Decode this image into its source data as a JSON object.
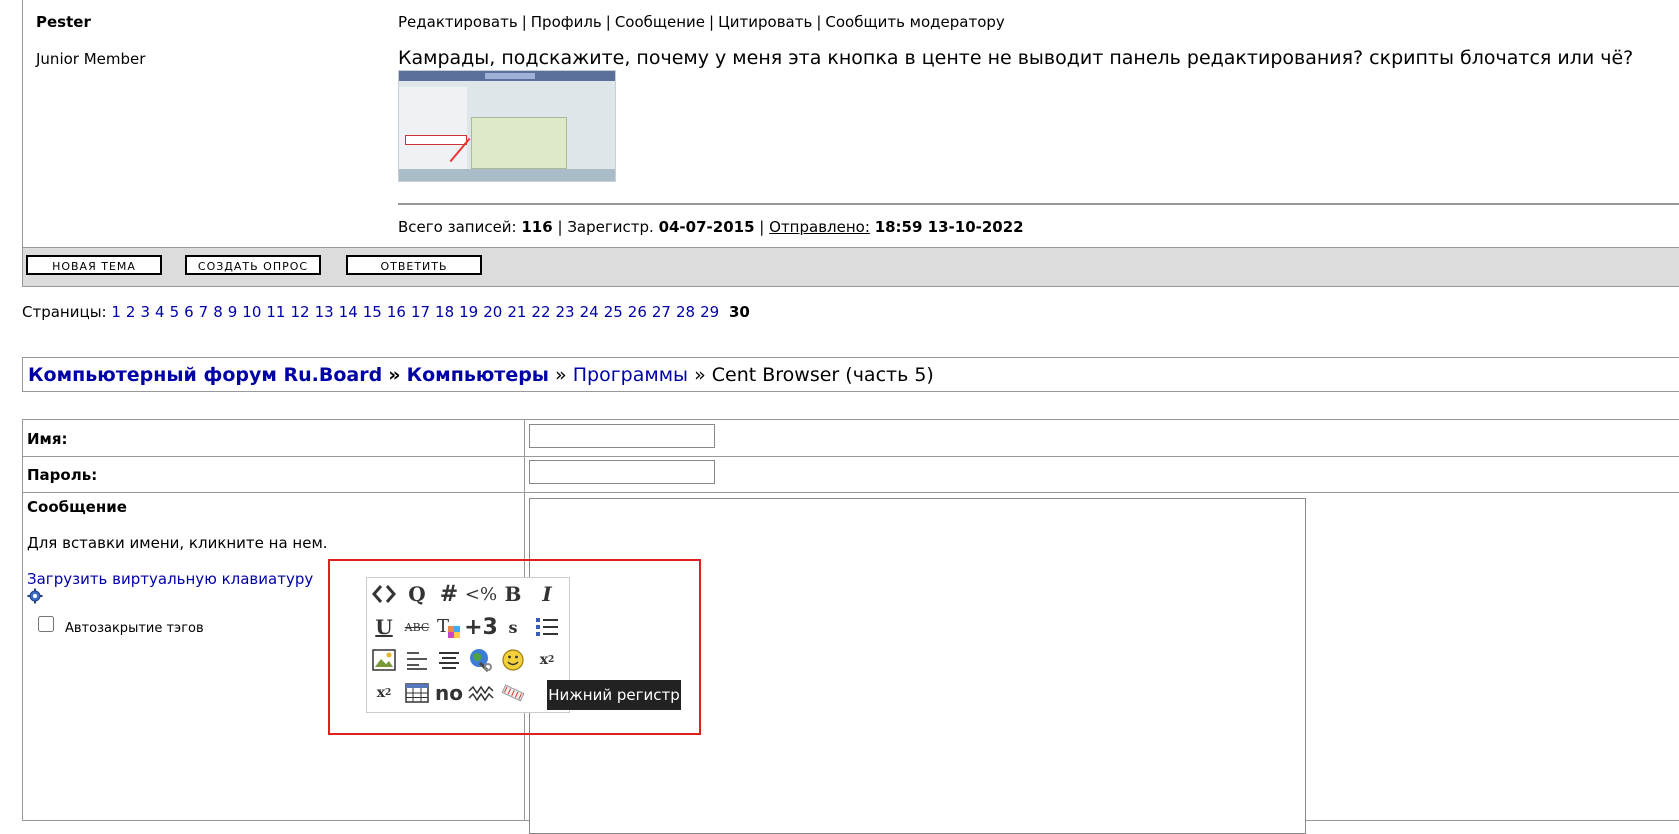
{
  "post": {
    "author": "Pester",
    "rank": "Junior Member",
    "actions": [
      "Редактировать",
      "Профиль",
      "Сообщение",
      "Цитировать",
      "Сообщить модератору"
    ],
    "text": "Камрады, подскажите, почему у меня эта кнопка в центе не выводит панель редактирования? скрипты блочатся или чё?",
    "stats": {
      "posts_label": "Всего записей:",
      "posts": "116",
      "reg_label": "Зарегистр.",
      "reg_date": "04-07-2015",
      "sent_label": "Отправлено:",
      "sent": "18:59 13-10-2022"
    }
  },
  "buttons": {
    "new_topic": "НОВАЯ ТЕМА",
    "new_poll": "СОЗДАТЬ ОПРОС",
    "reply": "ОТВЕТИТЬ"
  },
  "pages": {
    "label": "Страницы:",
    "items": [
      "1",
      "2",
      "3",
      "4",
      "5",
      "6",
      "7",
      "8",
      "9",
      "10",
      "11",
      "12",
      "13",
      "14",
      "15",
      "16",
      "17",
      "18",
      "19",
      "20",
      "21",
      "22",
      "23",
      "24",
      "25",
      "26",
      "27",
      "28",
      "29"
    ],
    "current": "30"
  },
  "breadcrumb": {
    "forum": "Компьютерный форум Ru.Board",
    "sep": "»",
    "section": "Компьютеры",
    "subsection": "Программы",
    "topic": "Cent Browser (часть 5)"
  },
  "form": {
    "name_label": "Имя:",
    "password_label": "Пароль:",
    "message_label": "Сообщение",
    "insert_hint": "Для вставки имени, кликните на нем.",
    "vkbd_link": "Загрузить виртуальную клавиатуру",
    "autoclose_label": "Автозакрытие тэгов"
  },
  "toolbar": {
    "tooltip": "Нижний регистр",
    "icons": [
      "code-icon",
      "quote-icon",
      "hash-icon",
      "less-percent-icon",
      "bold-icon",
      "italic-icon",
      "underline-icon",
      "strikethrough-abc-icon",
      "font-color-icon",
      "size-plus-icon",
      "small-s-icon",
      "list-icon",
      "image-icon",
      "align-left-icon",
      "align-center-icon",
      "globe-link-icon",
      "smiley-icon",
      "subscript-icon",
      "superscript-icon",
      "table-icon",
      "noparse-icon",
      "wave-icon",
      "lowercase-icon"
    ],
    "size_plus_text": "+3",
    "noparse_text": "no"
  },
  "colors": {
    "link": "#0000a8",
    "highlight_box": "#e0201e",
    "button_bar": "#dcdcdc"
  }
}
